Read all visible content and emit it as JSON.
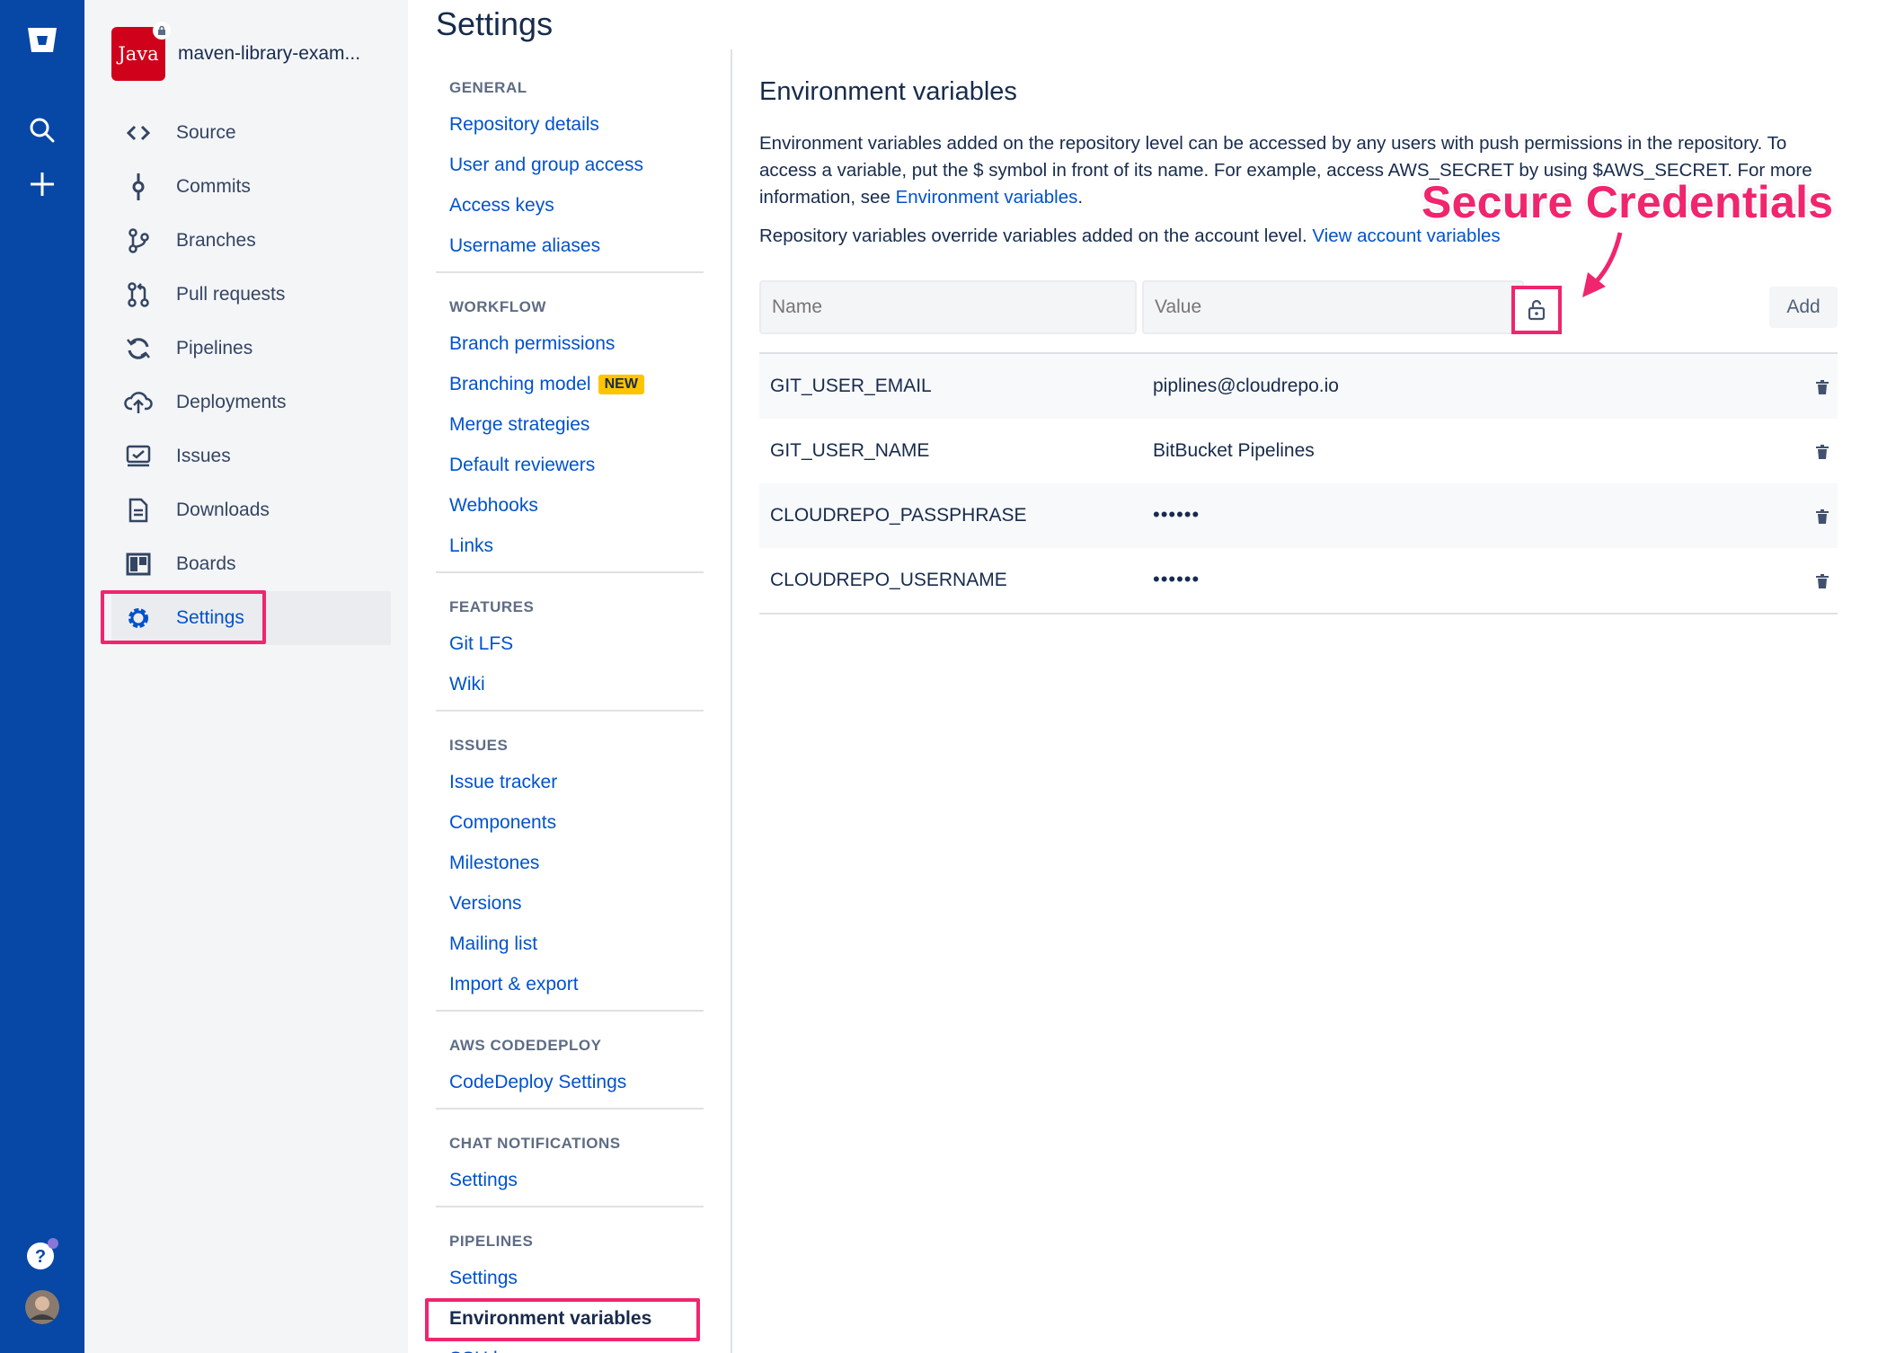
{
  "global_nav": {
    "logo_icon": "bitbucket-logo-icon",
    "search_icon": "search-icon",
    "create_icon": "plus-icon",
    "help_icon": "help-icon",
    "avatar_icon": "user-avatar"
  },
  "repo": {
    "avatar_label": "Java",
    "name": "maven-library-exam..."
  },
  "sidebar": {
    "items": [
      {
        "label": "Source",
        "icon": "code-icon"
      },
      {
        "label": "Commits",
        "icon": "commit-icon"
      },
      {
        "label": "Branches",
        "icon": "branch-icon"
      },
      {
        "label": "Pull requests",
        "icon": "pull-request-icon"
      },
      {
        "label": "Pipelines",
        "icon": "pipelines-icon"
      },
      {
        "label": "Deployments",
        "icon": "deployments-icon"
      },
      {
        "label": "Issues",
        "icon": "issues-icon"
      },
      {
        "label": "Downloads",
        "icon": "downloads-icon"
      },
      {
        "label": "Boards",
        "icon": "boards-icon"
      },
      {
        "label": "Settings",
        "icon": "gear-icon",
        "active": true
      }
    ]
  },
  "settings": {
    "title": "Settings",
    "groups": [
      {
        "heading": "GENERAL",
        "items": [
          "Repository details",
          "User and group access",
          "Access keys",
          "Username aliases"
        ]
      },
      {
        "heading": "WORKFLOW",
        "items": [
          "Branch permissions",
          "Branching model",
          "Merge strategies",
          "Default reviewers",
          "Webhooks",
          "Links"
        ]
      },
      {
        "heading": "FEATURES",
        "items": [
          "Git LFS",
          "Wiki"
        ]
      },
      {
        "heading": "ISSUES",
        "items": [
          "Issue tracker",
          "Components",
          "Milestones",
          "Versions",
          "Mailing list",
          "Import & export"
        ]
      },
      {
        "heading": "AWS CODEDEPLOY",
        "items": [
          "CodeDeploy Settings"
        ]
      },
      {
        "heading": "CHAT NOTIFICATIONS",
        "items": [
          "Settings"
        ]
      },
      {
        "heading": "PIPELINES",
        "items": [
          "Settings",
          "Environment variables",
          "SSH keys"
        ]
      }
    ],
    "new_badge": "NEW"
  },
  "env": {
    "title": "Environment variables",
    "desc_part1": "Environment variables added on the repository level can be accessed by any users with push permissions in the repository. To access a variable, put the $ symbol in front of its name. For example, access AWS_SECRET by using $AWS_SECRET. For more information, see ",
    "desc_link": "Environment variables",
    "desc_end": ".",
    "override_text": "Repository variables override variables added on the account level. ",
    "override_link": "View account variables",
    "annotation": "Secure Credentials",
    "annotation_color": "#F0256E",
    "form": {
      "name_placeholder": "Name",
      "value_placeholder": "Value",
      "secure_icon": "lock-icon",
      "add_label": "Add"
    },
    "variables": [
      {
        "name": "GIT_USER_EMAIL",
        "value": "piplines@cloudrepo.io",
        "secured": false
      },
      {
        "name": "GIT_USER_NAME",
        "value": "BitBucket Pipelines",
        "secured": false
      },
      {
        "name": "CLOUDREPO_PASSPHRASE",
        "value": "••••••",
        "secured": true
      },
      {
        "name": "CLOUDREPO_USERNAME",
        "value": "••••••",
        "secured": true
      }
    ]
  },
  "colors": {
    "global_nav": "#0747A6",
    "link": "#0052CC",
    "highlight": "#F0256E",
    "badge": "#FFC400"
  }
}
